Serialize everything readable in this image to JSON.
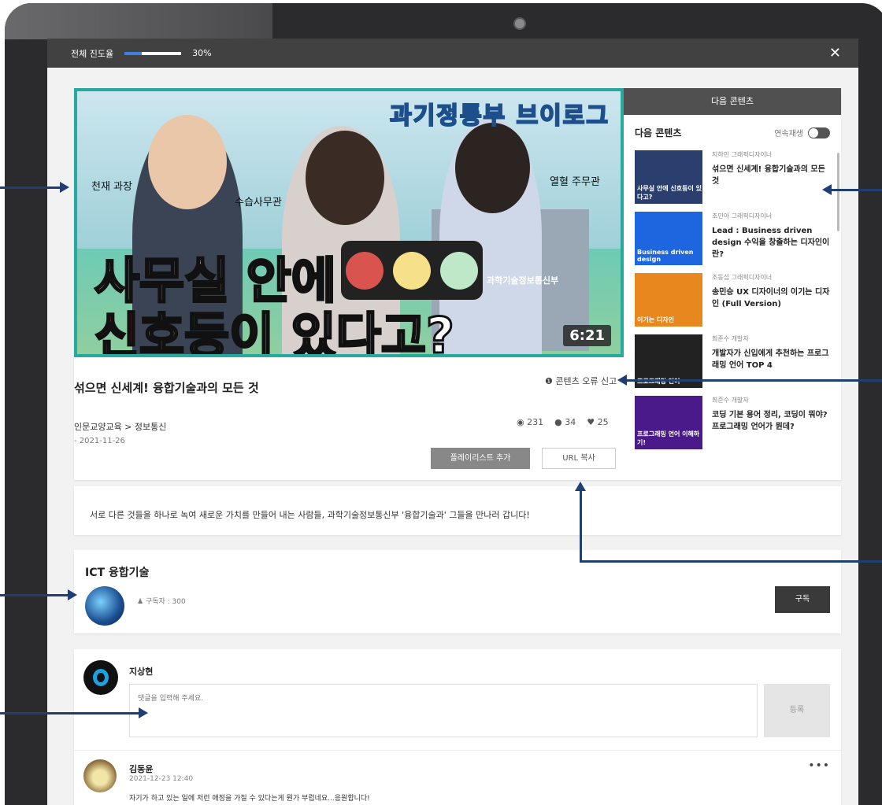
{
  "topbar": {
    "progress_label": "전체 진도율",
    "progress_value": 0.3,
    "progress_text": "30%"
  },
  "video": {
    "header_text": "과기정통부 브이로그",
    "headline_line1": "사무실 안에",
    "headline_line2_red": "신",
    "headline_line2_yellow": "호",
    "headline_line2_green": "등",
    "headline_line2_rest": "이 있다고?",
    "tag_left": "천재 과장",
    "tag_middle": "수습사무관",
    "tag_right": "열혈 주무관",
    "building_sign": "과학기술정보통신부",
    "duration": "6:21"
  },
  "content": {
    "title": "섞으면 신세계! 융합기술과의 모든 것",
    "report_label": "콘텐츠 오류 신고",
    "breadcrumb": "인문교양교육 > 정보통신",
    "date": "- 2021-11-26",
    "views": "231",
    "comments": "34",
    "likes": "25",
    "playlist_button": "플레이리스트 추가",
    "url_button": "URL 복사"
  },
  "next_panel": {
    "header": "다음 콘텐츠",
    "subheader": "다음 콘텐츠",
    "autoplay_label": "연속재생",
    "items": [
      {
        "author": "지하민 그래픽디자이너",
        "title": "섞으면 신세계! 융합기술과의 모든 것",
        "thumb_text": "사무실 안에 신호등이 있다고?",
        "thumb_color": "#2a3f6e"
      },
      {
        "author": "조민아 그래픽디자이너",
        "title": "Lead : Business driven design 수익을 창출하는 디자인이란?",
        "thumb_text": "Business driven design",
        "thumb_color": "#1e66e0"
      },
      {
        "author": "조동섭 그래픽디자이너",
        "title": "송민승 UX 디자이너의 이기는 디자인 (Full Version)",
        "thumb_text": "이기는 디자인",
        "thumb_color": "#e8871e"
      },
      {
        "author": "최준수 개발자",
        "title": "개발자가 신입에게 추천하는 프로그래밍 언어 TOP 4",
        "thumb_text": "프로그래밍 언어",
        "thumb_color": "#222222"
      },
      {
        "author": "최준수 개발자",
        "title": "코딩 기본 용어 정리, 코딩이 뭐야? 프로그래밍 언어가 뭔데?",
        "thumb_text": "프로그래밍 언어 이해하기!",
        "thumb_color": "#4a1a8a"
      }
    ]
  },
  "description": "서로 다른 것들을 하나로 녹여 새로운 가치를 만들어 내는 사람들, 과학기술정보통신부 '융합기술과' 그들을 만나러 갑니다!",
  "channel": {
    "name": "ICT 융합기술",
    "subscribers": "구독자 : 300",
    "subscribe_button": "구독"
  },
  "comment_form": {
    "user": "지상현",
    "placeholder": "댓글을 입력해 주세요.",
    "submit": "등록"
  },
  "comments": [
    {
      "user": "김동윤",
      "date": "2021-12-23 12:40",
      "text": "자기가 하고 있는 일에 저런 애정을 가질 수 있다는게 뭔가 부럽네요...응원합니다!"
    }
  ]
}
